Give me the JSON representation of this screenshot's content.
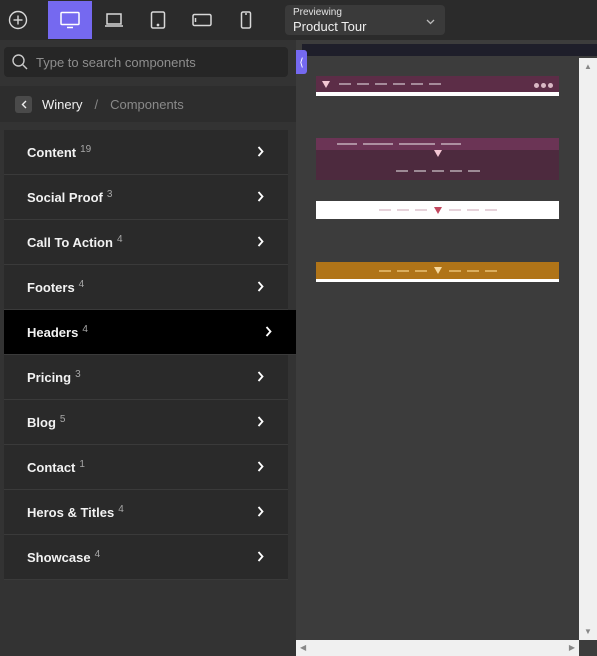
{
  "toolbar": {
    "devices": [
      "desktop-icon",
      "laptop-icon",
      "tablet-icon",
      "tablet-landscape-icon",
      "mobile-icon"
    ],
    "active_device": "desktop-icon",
    "previewing_label": "Previewing",
    "previewing_value": "Product Tour"
  },
  "search": {
    "placeholder": "Type to search components"
  },
  "breadcrumb": {
    "current": "Winery",
    "separator": "/",
    "sub": "Components"
  },
  "categories": [
    {
      "label": "Content",
      "count": "19"
    },
    {
      "label": "Social Proof",
      "count": "3"
    },
    {
      "label": "Call To Action",
      "count": "4"
    },
    {
      "label": "Footers",
      "count": "4"
    },
    {
      "label": "Headers",
      "count": "4",
      "active": true
    },
    {
      "label": "Pricing",
      "count": "3"
    },
    {
      "label": "Blog",
      "count": "5"
    },
    {
      "label": "Contact",
      "count": "1"
    },
    {
      "label": "Heros & Titles",
      "count": "4"
    },
    {
      "label": "Showcase",
      "count": "4"
    }
  ],
  "colors": {
    "accent": "#7569f0",
    "header_thumb_1": "#5c2d47",
    "header_thumb_2": "#6b3455",
    "header_thumb_3": "#ffffff",
    "header_thumb_4": "#b07418"
  }
}
